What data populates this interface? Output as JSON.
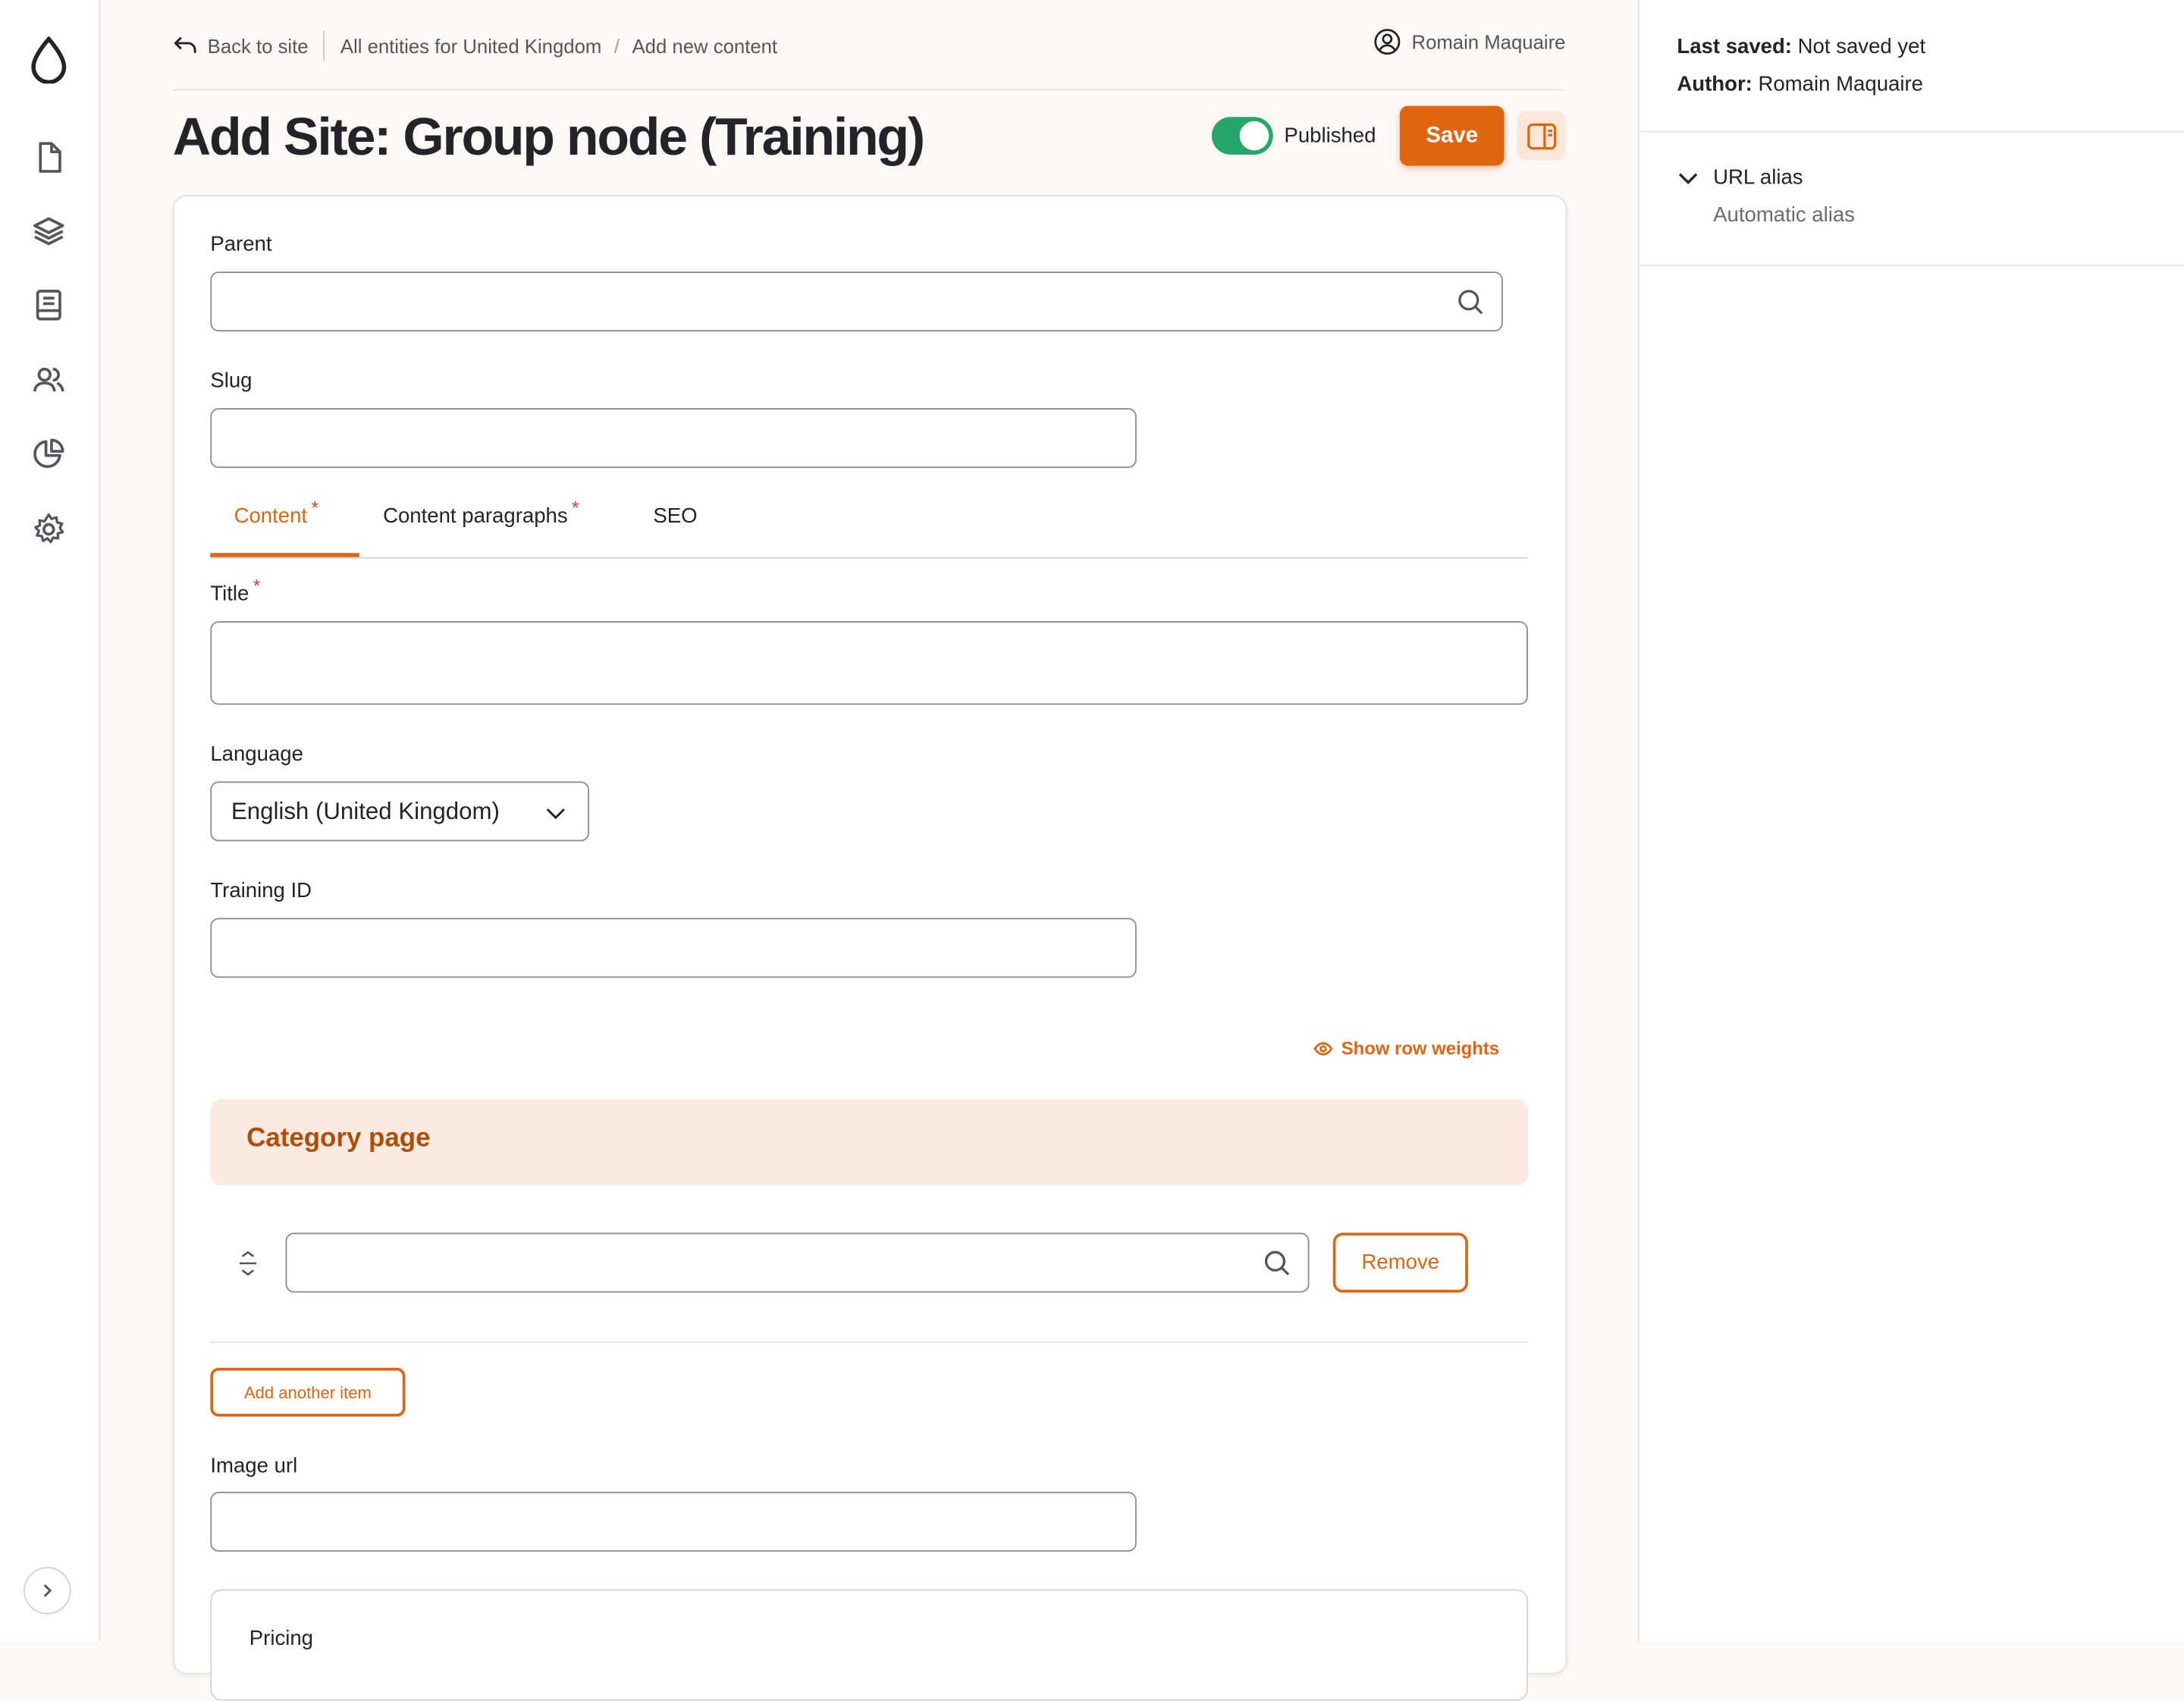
{
  "breadcrumb": {
    "back_label": "Back to site",
    "items": [
      "All entities for United Kingdom",
      "Add new content"
    ]
  },
  "user": {
    "name": "Romain Maquaire"
  },
  "page": {
    "title": "Add Site: Group node (Training)"
  },
  "status": {
    "published_label": "Published",
    "published": true
  },
  "actions": {
    "save_label": "Save"
  },
  "toolbar": {
    "icons": [
      "drupal-logo-icon",
      "document-icon",
      "layers-icon",
      "book-icon",
      "users-icon",
      "reports-icon",
      "gear-icon",
      "expand-icon"
    ]
  },
  "form": {
    "parent": {
      "label": "Parent",
      "value": ""
    },
    "slug": {
      "label": "Slug",
      "value": ""
    },
    "tabs": [
      {
        "label": "Content",
        "required": "*"
      },
      {
        "label": "Content paragraphs",
        "required": "*"
      },
      {
        "label": "SEO"
      }
    ],
    "title": {
      "label": "Title",
      "required": "*",
      "value": ""
    },
    "language": {
      "label": "Language",
      "value": "English (United Kingdom)"
    },
    "training_id": {
      "label": "Training ID",
      "value": ""
    },
    "row_weights_label": "Show row weights",
    "category": {
      "title": "Category page",
      "remove_label": "Remove",
      "value": ""
    },
    "add_item_label": "Add another item",
    "image_url": {
      "label": "Image url",
      "value": ""
    },
    "pricing": {
      "label": "Pricing"
    }
  },
  "sidebar": {
    "last_saved_label": "Last saved:",
    "last_saved_value": "Not saved yet",
    "author_label": "Author:",
    "author_value": "Romain Maquaire",
    "url_alias_label": "URL alias",
    "url_alias_value": "Automatic alias"
  },
  "colors": {
    "accent": "#e06511",
    "toggle_on": "#26a769",
    "band": "#faeae0"
  }
}
